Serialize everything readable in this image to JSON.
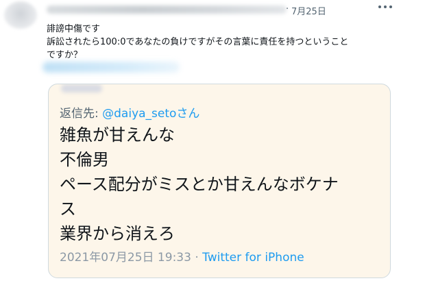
{
  "tweet": {
    "date": "7月25日",
    "separator": "·",
    "body_lines": [
      "誹謗中傷です",
      "訴訟されたら100:0であなたの負けですがその言葉に責任を持つということ",
      "ですか？"
    ]
  },
  "quote": {
    "reply_prefix": "返信先: ",
    "reply_handle": "@daiya_setoさん",
    "lines": [
      "雑魚が甘えんな",
      "不倫男",
      "ペース配分がミスとか甘えんなボケナ",
      "ス",
      "業界から消えろ"
    ],
    "timestamp": "2021年07月25日 19:33",
    "meta_separator": " · ",
    "source": "Twitter for iPhone"
  },
  "colors": {
    "link_blue": "#1d9bf0",
    "secondary_gray": "#536471",
    "quote_background": "#fdf6ea"
  },
  "icons": [
    "more-icon"
  ]
}
